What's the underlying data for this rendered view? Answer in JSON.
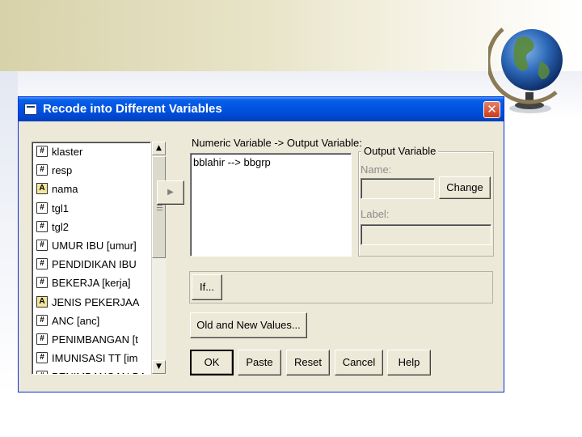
{
  "dialog": {
    "title": "Recode into Different Variables",
    "close_glyph": "✕"
  },
  "variables": [
    {
      "label": "klaster",
      "type": "numeric"
    },
    {
      "label": "resp",
      "type": "numeric"
    },
    {
      "label": "nama",
      "type": "string"
    },
    {
      "label": "tgl1",
      "type": "numeric"
    },
    {
      "label": "tgl2",
      "type": "numeric"
    },
    {
      "label": "UMUR IBU [umur]",
      "type": "numeric"
    },
    {
      "label": "PENDIDIKAN IBU",
      "type": "numeric"
    },
    {
      "label": "BEKERJA [kerja]",
      "type": "numeric"
    },
    {
      "label": "JENIS PEKERJAA",
      "type": "string"
    },
    {
      "label": "ANC [anc]",
      "type": "numeric"
    },
    {
      "label": "PENIMBANGAN [t",
      "type": "numeric"
    },
    {
      "label": "IMUNISASI TT [im",
      "type": "numeric"
    },
    {
      "label": "PENIMBANGAN BA",
      "type": "numeric"
    }
  ],
  "icons": {
    "numeric": "#",
    "string": "A"
  },
  "mapping": {
    "header": "Numeric Variable -> Output Variable:",
    "items": [
      "bblahir --> bbgrp"
    ]
  },
  "output_variable": {
    "group_title": "Output Variable",
    "name_label": "Name:",
    "name_value": "",
    "change_label": "Change",
    "label_label": "Label:",
    "label_value": ""
  },
  "buttons": {
    "move": "▶",
    "if": "If...",
    "old_new": "Old and New Values...",
    "ok": "OK",
    "paste": "Paste",
    "reset": "Reset",
    "cancel": "Cancel",
    "help": "Help"
  },
  "colors": {
    "titlebar": "#0054e3",
    "dialog_bg": "#ece9d8",
    "close": "#c83a1a"
  }
}
